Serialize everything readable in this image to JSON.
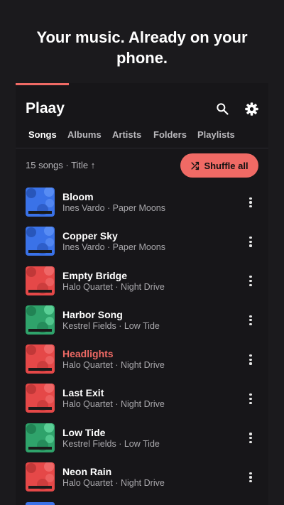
{
  "hero": {
    "headline": "Your music. Already on your phone."
  },
  "app": {
    "title": "Plaay"
  },
  "header_icons": [
    "search-icon",
    "gear-icon"
  ],
  "tabs": [
    {
      "label": "Songs",
      "active": true
    },
    {
      "label": "Albums",
      "active": false
    },
    {
      "label": "Artists",
      "active": false
    },
    {
      "label": "Folders",
      "active": false
    },
    {
      "label": "Playlists",
      "active": false
    }
  ],
  "list_info": {
    "summary": "15 songs · Title ↑"
  },
  "shuffle": {
    "label": "Shuffle all",
    "icon": "shuffle-icon"
  },
  "colors": {
    "accent": "#f06a65",
    "blue_art": "#3a72e8",
    "red_art": "#e54848",
    "green_art": "#2fa36b",
    "background": "#1b1a1d"
  },
  "songs": [
    {
      "title": "Bloom",
      "meta": "Ines Vardo · Paper Moons",
      "art": "blue",
      "playing": false
    },
    {
      "title": "Copper Sky",
      "meta": "Ines Vardo · Paper Moons",
      "art": "blue",
      "playing": false
    },
    {
      "title": "Empty Bridge",
      "meta": "Halo Quartet · Night Drive",
      "art": "red",
      "playing": false
    },
    {
      "title": "Harbor Song",
      "meta": "Kestrel Fields · Low Tide",
      "art": "green",
      "playing": false
    },
    {
      "title": "Headlights",
      "meta": "Halo Quartet · Night Drive",
      "art": "red",
      "playing": true
    },
    {
      "title": "Last Exit",
      "meta": "Halo Quartet · Night Drive",
      "art": "red",
      "playing": false
    },
    {
      "title": "Low Tide",
      "meta": "Kestrel Fields · Low Tide",
      "art": "green",
      "playing": false
    },
    {
      "title": "Neon Rain",
      "meta": "Halo Quartet · Night Drive",
      "art": "red",
      "playing": false
    }
  ]
}
